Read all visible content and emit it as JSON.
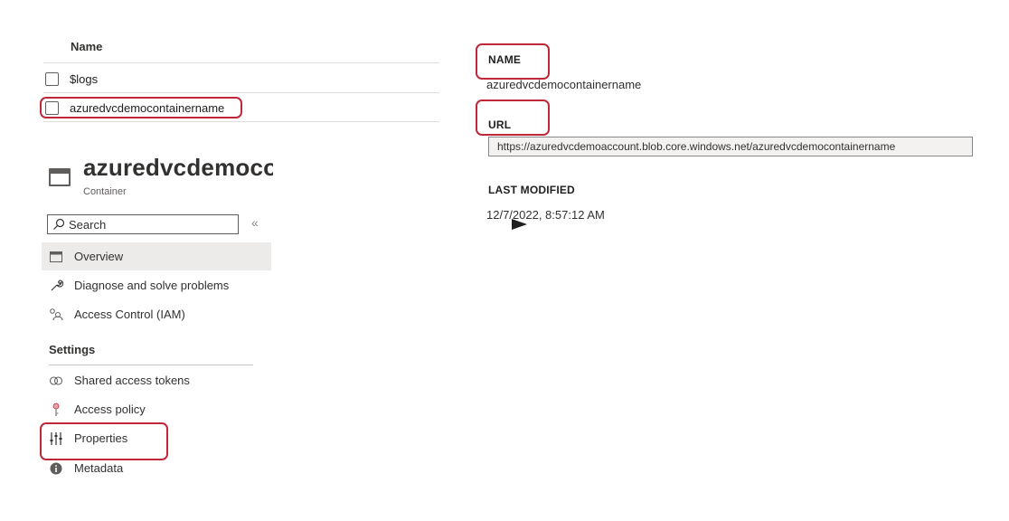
{
  "container_list": {
    "header": "Name",
    "rows": [
      {
        "name": "$logs"
      },
      {
        "name": "azuredvcdemocontainername"
      }
    ]
  },
  "container": {
    "title": "azuredvcdemocont",
    "subtitle": "Container",
    "icon": "container-icon"
  },
  "search": {
    "placeholder": "Search",
    "collapse_label": "«"
  },
  "nav": {
    "items": [
      {
        "label": "Overview",
        "icon": "overview-icon",
        "selected": true
      },
      {
        "label": "Diagnose and solve problems",
        "icon": "wrench-icon"
      },
      {
        "label": "Access Control (IAM)",
        "icon": "people-icon"
      }
    ],
    "settings_header": "Settings",
    "settings_items": [
      {
        "label": "Shared access tokens",
        "icon": "link-icon"
      },
      {
        "label": "Access policy",
        "icon": "key-icon"
      },
      {
        "label": "Properties",
        "icon": "properties-icon"
      },
      {
        "label": "Metadata",
        "icon": "info-icon"
      }
    ]
  },
  "properties": {
    "name_label": "NAME",
    "name_value": "azuredvcdemocontainername",
    "url_label": "URL",
    "url_value": "https://azuredvcdemoaccount.blob.core.windows.net/azuredvcdemocontainername",
    "last_modified_label": "LAST MODIFIED",
    "last_modified_value": "12/7/2022, 8:57:12 AM"
  },
  "colors": {
    "highlight": "#c0283a",
    "selected_bg": "#edebe9"
  }
}
